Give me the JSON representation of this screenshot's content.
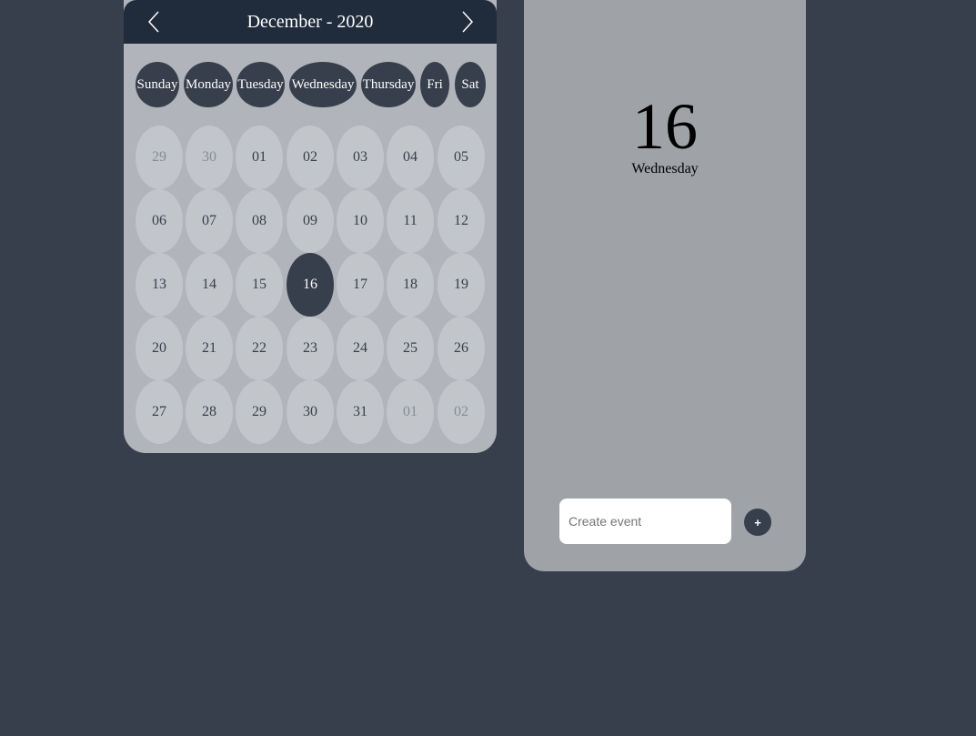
{
  "calendar": {
    "title": "December - 2020",
    "prev_icon": "chevron-left-icon",
    "next_icon": "chevron-right-icon",
    "weekdays": [
      "Sunday",
      "Monday",
      "Tuesday",
      "Wednesday",
      "Thursday",
      "Fri",
      "Sat"
    ],
    "weeks": [
      [
        "29",
        "30",
        "01",
        "02",
        "03",
        "04",
        "05"
      ],
      [
        "06",
        "07",
        "08",
        "09",
        "10",
        "11",
        "12"
      ],
      [
        "13",
        "14",
        "15",
        "16",
        "17",
        "18",
        "19"
      ],
      [
        "20",
        "21",
        "22",
        "23",
        "24",
        "25",
        "26"
      ],
      [
        "27",
        "28",
        "29",
        "30",
        "31",
        "01",
        "02"
      ]
    ],
    "selected_day": "16"
  },
  "panel": {
    "date": "16",
    "weekday": "Wednesday",
    "event_placeholder": "Create event",
    "add_label": "+"
  },
  "colors": {
    "background": "#363f4b",
    "header": "#202c3c",
    "selected": "#363f4b"
  }
}
